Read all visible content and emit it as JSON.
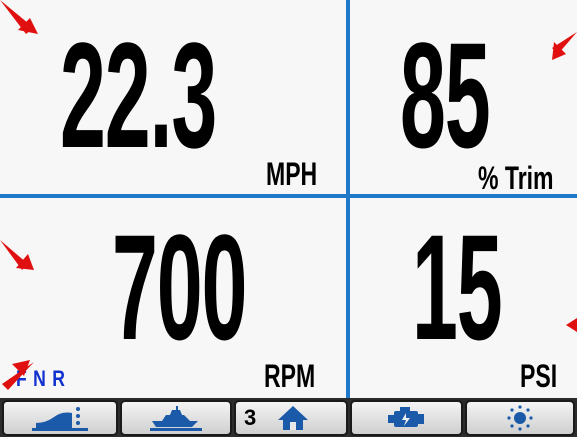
{
  "gauges": {
    "speed": {
      "value": "22.3",
      "unit": "MPH"
    },
    "trim": {
      "value": "85",
      "unit": "% Trim"
    },
    "rpm": {
      "value": "700",
      "unit": "RPM"
    },
    "pressure": {
      "value": "15",
      "unit": "PSI"
    }
  },
  "gear": {
    "forward": "F",
    "neutral": "N",
    "reverse": "R"
  },
  "toolbar": {
    "page_number": "3",
    "buttons": [
      {
        "icon": "trim-tab-icon"
      },
      {
        "icon": "boat-icon"
      },
      {
        "icon": "home-icon"
      },
      {
        "icon": "engine-icon"
      },
      {
        "icon": "brightness-icon"
      }
    ]
  },
  "colors": {
    "divider": "#1f79c8",
    "gear_text": "#1030d0",
    "icon_blue": "#1a5aa8",
    "arrow_red": "#e01010"
  }
}
